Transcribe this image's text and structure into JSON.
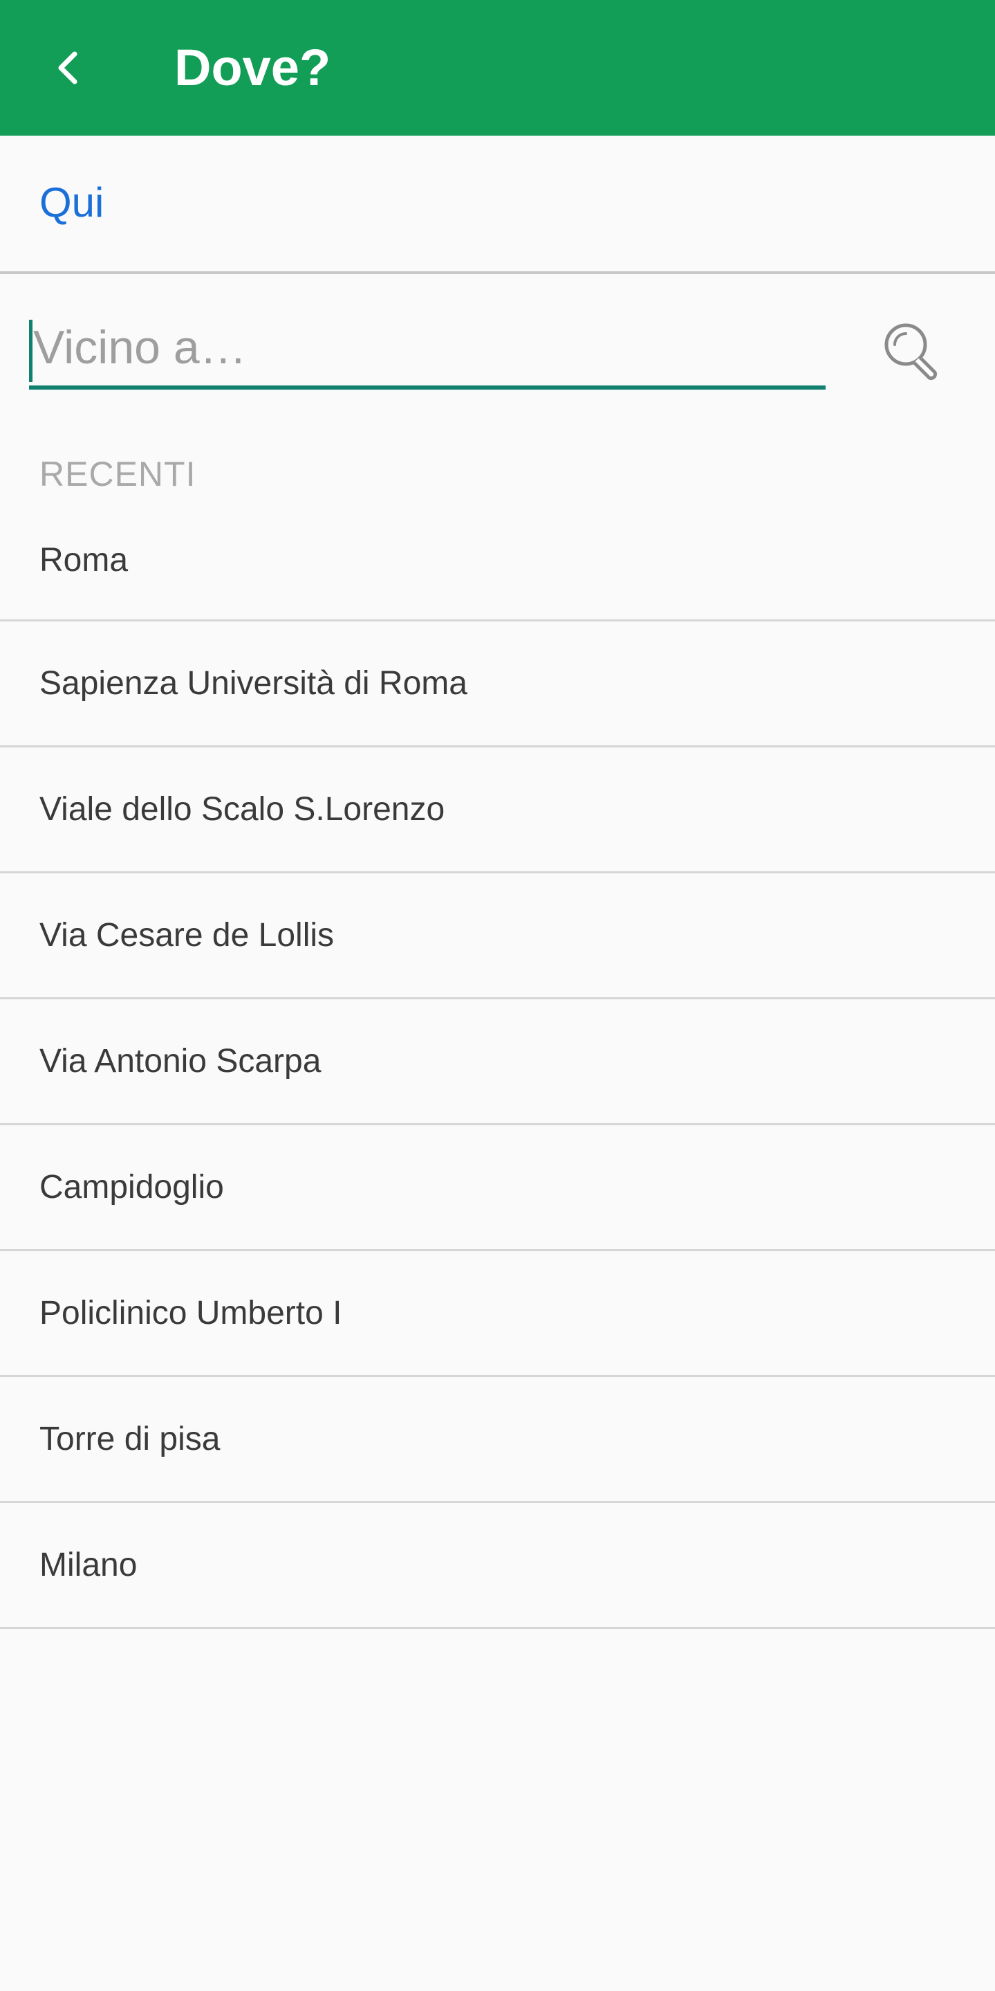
{
  "header": {
    "title": "Dove?",
    "back_icon": "chevron-left-icon",
    "background_color": "#129e56"
  },
  "current_location": {
    "label": "Qui",
    "color": "#1a6fd8"
  },
  "search": {
    "placeholder": "Vicino a…",
    "value": "",
    "icon": "magnifier-icon",
    "accent_color": "#11806f"
  },
  "recent": {
    "title": "RECENTI",
    "items": [
      {
        "label": "Roma"
      },
      {
        "label": "Sapienza Università di Roma"
      },
      {
        "label": "Viale dello Scalo S.Lorenzo"
      },
      {
        "label": "Via Cesare de Lollis"
      },
      {
        "label": "Via Antonio Scarpa"
      },
      {
        "label": "Campidoglio"
      },
      {
        "label": "Policlinico Umberto I"
      },
      {
        "label": "Torre di pisa"
      },
      {
        "label": "Milano"
      }
    ]
  }
}
